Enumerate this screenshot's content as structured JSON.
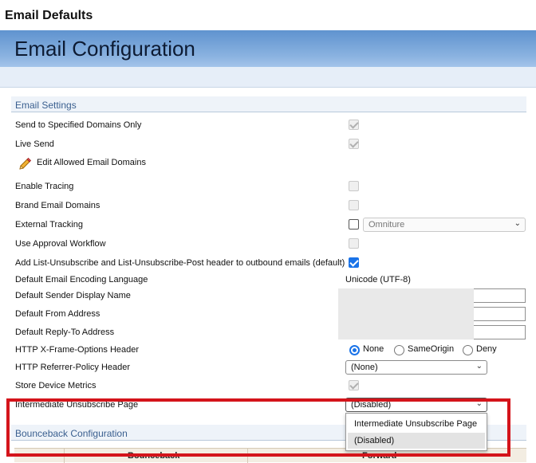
{
  "window": {
    "title": "Email Defaults"
  },
  "banner": {
    "title": "Email Configuration"
  },
  "email_settings": {
    "header": "Email Settings",
    "send_specified_domains": {
      "label": "Send to Specified Domains Only",
      "checked": true,
      "disabled": true
    },
    "live_send": {
      "label": "Live Send",
      "checked": true,
      "disabled": true
    },
    "edit_domains_link": "Edit Allowed Email Domains",
    "enable_tracing": {
      "label": "Enable Tracing",
      "checked": false
    },
    "brand_email_domains": {
      "label": "Brand Email Domains",
      "checked": false
    },
    "external_tracking": {
      "label": "External Tracking",
      "checked": false,
      "provider": "Omniture"
    },
    "use_approval_workflow": {
      "label": "Use Approval Workflow",
      "checked": false
    },
    "list_unsubscribe_header": {
      "label": "Add List-Unsubscribe and List-Unsubscribe-Post header to outbound emails (default)",
      "checked": true
    },
    "encoding_language": {
      "label": "Default Email Encoding Language",
      "value": "Unicode (UTF-8)"
    },
    "sender_display_name": {
      "label": "Default Sender Display Name",
      "value": ""
    },
    "from_address": {
      "label": "Default From Address",
      "value": ""
    },
    "reply_to_address": {
      "label": "Default Reply-To Address",
      "value": ""
    },
    "x_frame_options": {
      "label": "HTTP X-Frame-Options Header",
      "options": [
        "None",
        "SameOrigin",
        "Deny"
      ],
      "selected": "None"
    },
    "referrer_policy": {
      "label": "HTTP Referrer-Policy Header",
      "value": "(None)"
    },
    "store_device_metrics": {
      "label": "Store Device Metrics",
      "checked": true,
      "disabled": true
    },
    "intermediate_unsubscribe": {
      "label": "Intermediate Unsubscribe Page",
      "value": "(Disabled)",
      "options": [
        "Intermediate Unsubscribe Page",
        "(Disabled)"
      ]
    }
  },
  "bounceback": {
    "header": "Bounceback Configuration",
    "columns": [
      "Bounceback",
      "Forward"
    ]
  },
  "colors": {
    "accent": "#1a73e8",
    "highlight": "#d4141b",
    "banner": "#6f9fd8"
  }
}
